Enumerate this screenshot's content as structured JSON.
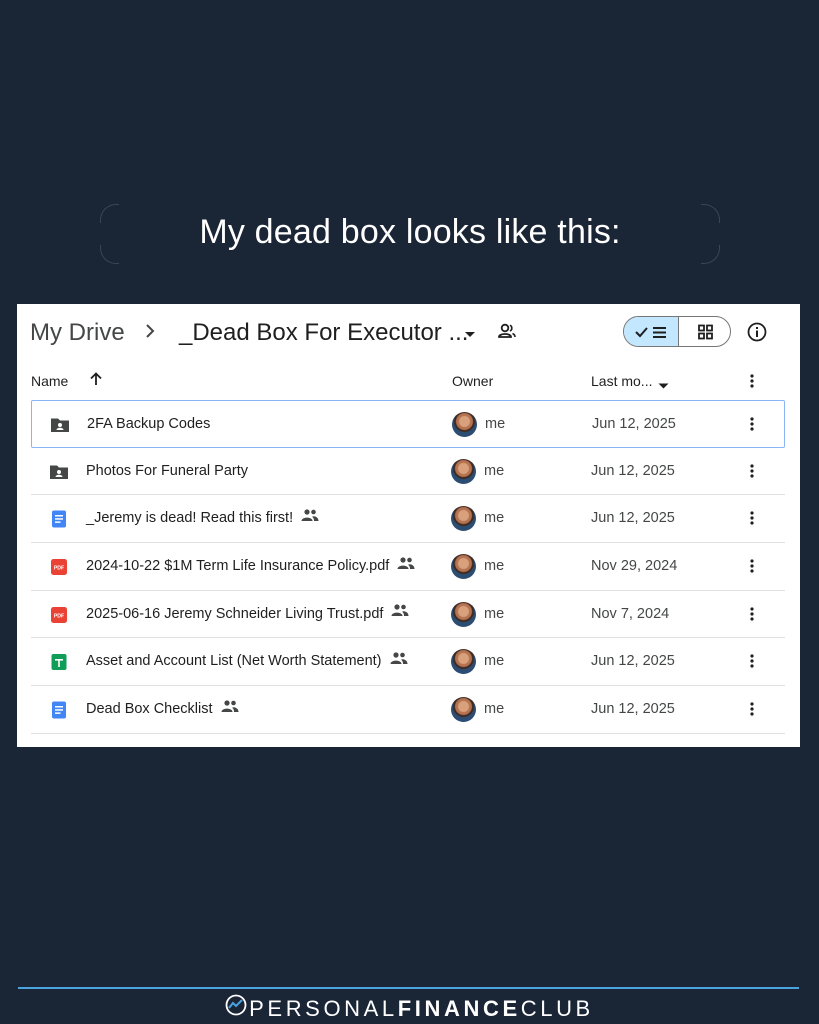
{
  "headline": "My dead box looks like this:",
  "breadcrumb": {
    "root": "My Drive",
    "folder": "_Dead Box For Executor ..."
  },
  "columns": {
    "name": "Name",
    "owner": "Owner",
    "modified": "Last mo..."
  },
  "files": [
    {
      "name": "2FA Backup Codes",
      "icon": "shared-folder-icon",
      "shared": false,
      "owner": "me",
      "date": "Jun 12, 2025"
    },
    {
      "name": "Photos For Funeral Party",
      "icon": "shared-folder-icon",
      "shared": false,
      "owner": "me",
      "date": "Jun 12, 2025"
    },
    {
      "name": "_Jeremy is dead! Read this first!",
      "icon": "google-doc-icon",
      "shared": true,
      "owner": "me",
      "date": "Jun 12, 2025"
    },
    {
      "name": "2024-10-22 $1M Term Life Insurance Policy.pdf",
      "icon": "pdf-icon",
      "shared": true,
      "owner": "me",
      "date": "Nov 29, 2024"
    },
    {
      "name": "2025-06-16 Jeremy Schneider Living Trust.pdf",
      "icon": "pdf-icon",
      "shared": true,
      "owner": "me",
      "date": "Nov 7, 2024"
    },
    {
      "name": "Asset and Account List (Net Worth Statement)",
      "icon": "google-sheet-icon",
      "shared": true,
      "owner": "me",
      "date": "Jun 12, 2025"
    },
    {
      "name": "Dead Box Checklist",
      "icon": "google-doc-icon",
      "shared": true,
      "owner": "me",
      "date": "Jun 12, 2025"
    }
  ],
  "footer": {
    "part1": "PERSONAL",
    "part2": "FINANCE",
    "part3": "CLUB"
  },
  "colors": {
    "background": "#1a2536",
    "accent": "#4aa3df",
    "selected_toggle": "#c2e7ff",
    "pdf": "#ea4335",
    "doc": "#4285f4",
    "sheet": "#0f9d58"
  }
}
